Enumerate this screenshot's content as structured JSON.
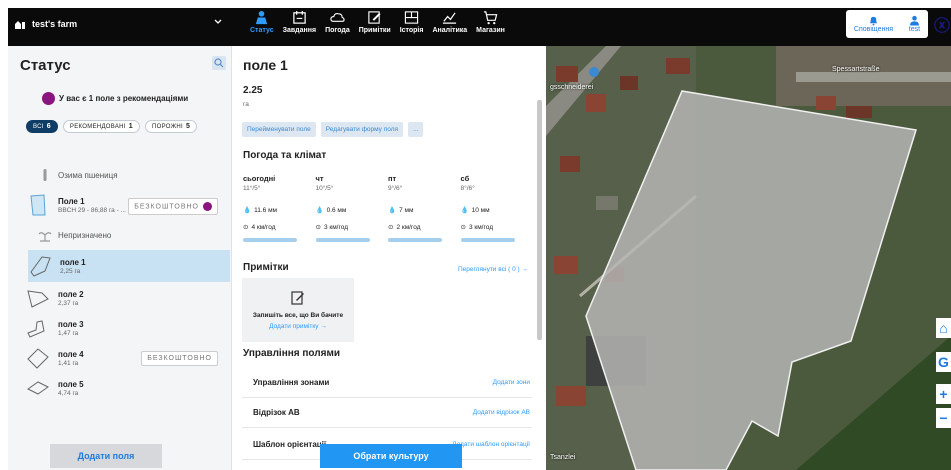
{
  "topbar": {
    "farm_name": "test's farm",
    "nav": [
      {
        "label": "Статус",
        "icon": "status-icon",
        "active": true
      },
      {
        "label": "Завдання",
        "icon": "tasks-icon",
        "active": false
      },
      {
        "label": "Погода",
        "icon": "weather-icon",
        "active": false
      },
      {
        "label": "Примітки",
        "icon": "notes-icon",
        "active": false
      },
      {
        "label": "Історія",
        "icon": "history-icon",
        "active": false
      },
      {
        "label": "Аналітика",
        "icon": "analytics-icon",
        "active": false
      },
      {
        "label": "Магазин",
        "icon": "shop-icon",
        "active": false
      }
    ],
    "notifications_label": "Сповіщення",
    "user_label": "test",
    "accent": "#2e9bff"
  },
  "sidebar": {
    "title": "Статус",
    "recommendation": "У вас є 1 поле з рекомендаціями",
    "filters": [
      {
        "label": "ВСІ",
        "count": "6",
        "selected": true
      },
      {
        "label": "РЕКОМЕНДОВАНІ",
        "count": "1",
        "selected": false
      },
      {
        "label": "ПОРОЖНІ",
        "count": "5",
        "selected": false
      }
    ],
    "group_crop": "Озима пшениця",
    "field_crop": {
      "name": "Поле 1",
      "info": "BBCH 29 - 86,88 га - ...",
      "free": "БЕЗКОШТОВНО"
    },
    "group_unassigned": "Непризначено",
    "fields": [
      {
        "name": "поле 1",
        "area": "2,25 га",
        "selected": true,
        "free": ""
      },
      {
        "name": "поле 2",
        "area": "2,37 га",
        "selected": false,
        "free": ""
      },
      {
        "name": "поле 3",
        "area": "1,47 га",
        "selected": false,
        "free": ""
      },
      {
        "name": "поле 4",
        "area": "1,41 га",
        "selected": false,
        "free": "БЕЗКОШТОВНО"
      },
      {
        "name": "поле 5",
        "area": "4,74 га",
        "selected": false,
        "free": ""
      }
    ],
    "add_fields": "Додати поля"
  },
  "details": {
    "title": "поле 1",
    "area": "2.25",
    "unit": "га",
    "actions": [
      "Перейменувати поле",
      "Редагувати форму поля",
      "..."
    ],
    "weather_title": "Погода та клімат",
    "weather": [
      {
        "day": "сьогодні",
        "temp": "11°/5°",
        "rain": "11.6 мм",
        "wind": "4 км/год"
      },
      {
        "day": "чт",
        "temp": "10°/5°",
        "rain": "0.6 мм",
        "wind": "3 км/год"
      },
      {
        "day": "пт",
        "temp": "9°/6°",
        "rain": "7 мм",
        "wind": "2 км/год"
      },
      {
        "day": "сб",
        "temp": "8°/6°",
        "rain": "10 мм",
        "wind": "3 км/год"
      }
    ],
    "notes_title": "Примітки",
    "notes_view_all": "Переглянути всі ( 0 ) →",
    "notes_empty": "Запишіть все, що Ви бачите",
    "notes_add": "Додати примітку →",
    "mgmt_title": "Управління полями",
    "mgmt": [
      {
        "label": "Управління зонами",
        "link": "Додати зони"
      },
      {
        "label": "Відрізок АВ",
        "link": "Додати відрізок АВ"
      },
      {
        "label": "Шаблон орієнтації",
        "link": "Додати шаблон орієнтації"
      }
    ],
    "choose_crop": "Обрати культуру"
  },
  "map": {
    "labels": [
      "gsschneiderei",
      "Spessartstraße",
      "Tsanzlei"
    ]
  }
}
